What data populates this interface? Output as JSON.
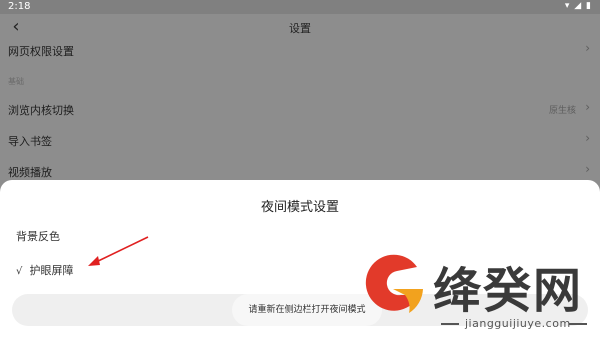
{
  "status_bar": {
    "time": "2:18"
  },
  "header": {
    "title": "设置"
  },
  "settings": {
    "rows": [
      {
        "label": "网页权限设置",
        "value": ""
      },
      {
        "label": "浏览内核切换",
        "value": "原生核"
      },
      {
        "label": "导入书签",
        "value": ""
      },
      {
        "label": "视频播放",
        "value": ""
      }
    ],
    "section_label": "基础"
  },
  "sheet": {
    "title": "夜间模式设置",
    "options": [
      {
        "label": "背景反色",
        "checked": false
      },
      {
        "label": "护眼屏障",
        "checked": true,
        "check_mark": "√"
      }
    ],
    "button_label": "请重新在侧边栏打开夜间模式"
  },
  "watermark": {
    "brand": "绛癸网",
    "url": "jiangguijiuye.com"
  },
  "colors": {
    "overlay": "#8d8d8d",
    "sheet_bg": "#ffffff",
    "annotation_arrow": "#e02020",
    "logo_red": "#e23a2a",
    "logo_orange": "#f2a21e"
  }
}
